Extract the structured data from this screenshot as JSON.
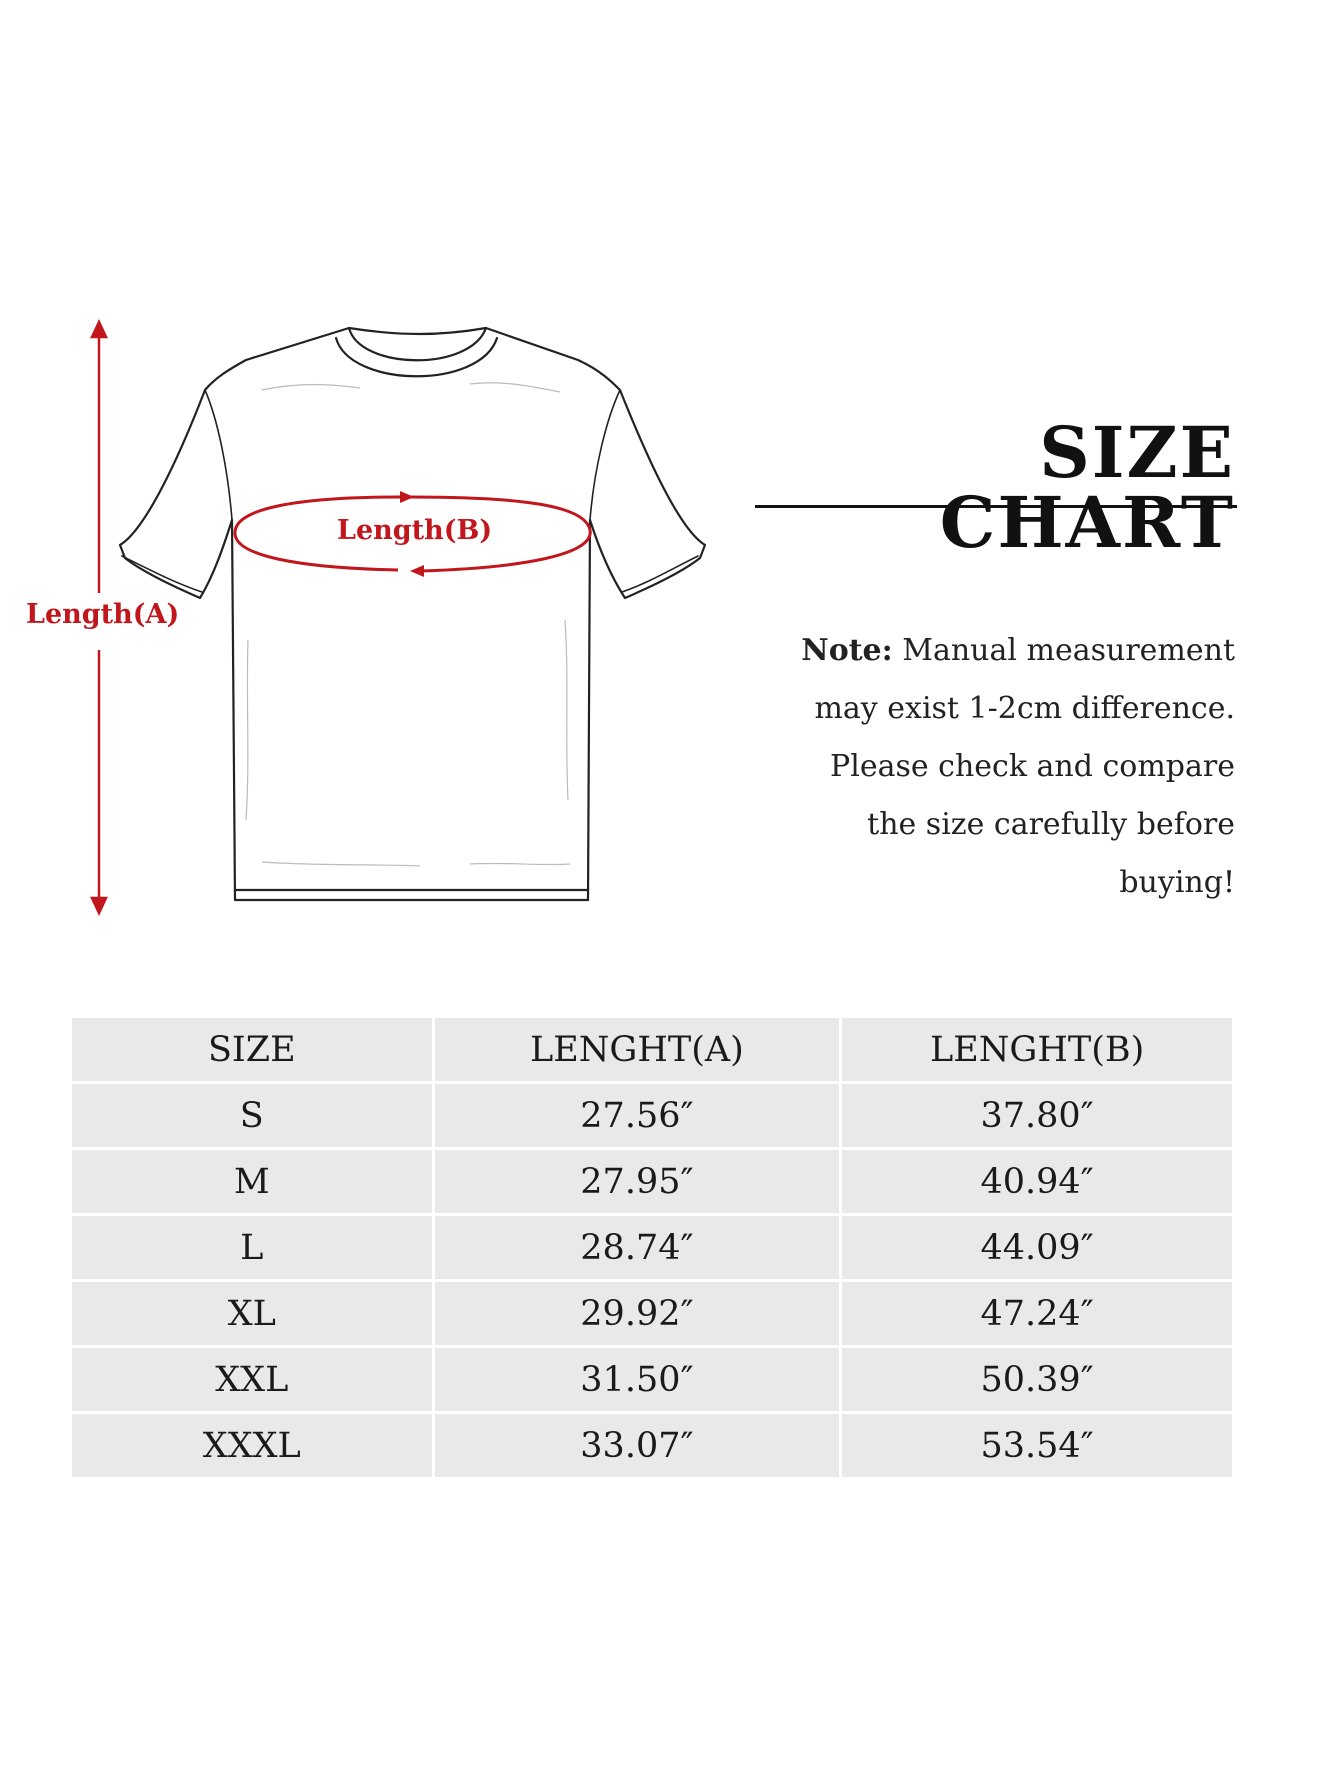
{
  "diagram": {
    "length_a_label": "Length(A)",
    "length_b_label": "Length(B)"
  },
  "heading": {
    "title": "SIZE CHART"
  },
  "note": {
    "prefix": "Note:",
    "line1": " Manual measurement",
    "line2": "may exist 1-2cm difference.",
    "line3": "Please check and compare",
    "line4": "the size carefully before",
    "line5": "buying!"
  },
  "table": {
    "headers": [
      "SIZE",
      "LENGHT(A)",
      "LENGHT(B)"
    ],
    "rows": [
      [
        "S",
        "27.56″",
        "37.80″"
      ],
      [
        "M",
        "27.95″",
        "40.94″"
      ],
      [
        "L",
        "28.74″",
        "44.09″"
      ],
      [
        "XL",
        "29.92″",
        "47.24″"
      ],
      [
        "XXL",
        "31.50″",
        "50.39″"
      ],
      [
        "XXXL",
        "33.07″",
        "53.54″"
      ]
    ]
  },
  "colors": {
    "accent": "#c0161c",
    "table_bg": "#e9e9e9",
    "text": "#1a1a1a"
  }
}
